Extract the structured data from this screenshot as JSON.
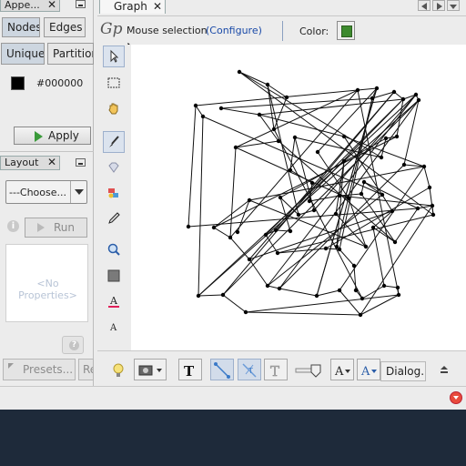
{
  "left_panel": {
    "appearance_tab": "Appe...",
    "nodes_tab": "Nodes",
    "edges_tab": "Edges",
    "unique_tab": "Unique",
    "partition_tab": "Partition",
    "color_hex": "#000000",
    "apply_label": "Apply",
    "layout_tab": "Layout",
    "layout_select": "---Choose...",
    "run_label": "Run",
    "no_properties": "<No Properties>",
    "presets_label": "Presets...",
    "reset_label": "Re"
  },
  "graph": {
    "tab_label": "Graph",
    "mouse_selection": "Mouse selection",
    "configure": "(Configure)",
    "color_label": "Color:",
    "node_color": "#3d8a2e",
    "font_label": "Dialog..."
  },
  "left_tools": [
    "pointer-icon",
    "rectangle-select-icon",
    "drag-hand-icon",
    "brush-icon",
    "diamond-icon",
    "painter-icon",
    "pencil-icon",
    "magnifier-icon",
    "shortest-path-icon",
    "text-color-icon",
    "text-size-icon"
  ],
  "bottom_tools": [
    "light-bulb-icon",
    "screenshot-icon",
    "text-label-icon",
    "edge-curved-icon",
    "edge-label-icon",
    "node-text-icon",
    "slider-icon",
    "font-size-icon",
    "font-color-icon",
    "collapse-icon"
  ],
  "colors": {
    "accent_blue": "#1a4aa8",
    "error_red": "#e84a3c",
    "taskbar": "#1e2a3a"
  }
}
